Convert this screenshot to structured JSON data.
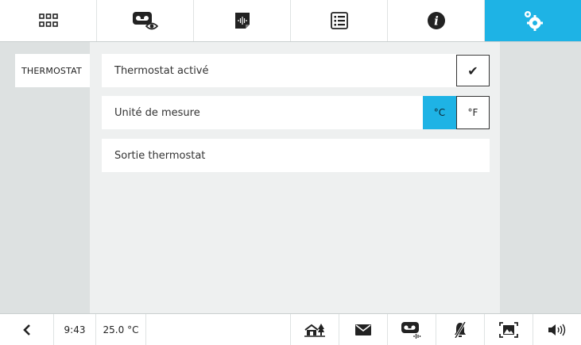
{
  "colors": {
    "accent": "#1eb3e5",
    "background": "#dde1e1",
    "panel": "#ffffff"
  },
  "top_tabs": [
    {
      "icon": "grid-icon",
      "active": false
    },
    {
      "icon": "voicemail-eye-icon",
      "active": false
    },
    {
      "icon": "audio-note-icon",
      "active": false
    },
    {
      "icon": "list-icon",
      "active": false
    },
    {
      "icon": "info-icon",
      "active": false
    },
    {
      "icon": "settings-gears-icon",
      "active": true
    }
  ],
  "sidebar": {
    "items": [
      {
        "label": "THERMOSTAT"
      }
    ]
  },
  "settings": {
    "thermostat_enabled": {
      "label": "Thermostat activé",
      "checked": true,
      "check_glyph": "✔"
    },
    "unit": {
      "label": "Unité de mesure",
      "options": [
        "°C",
        "°F"
      ],
      "selected": "°C"
    },
    "output": {
      "label": "Sortie thermostat"
    }
  },
  "bottombar": {
    "back_icon": "chevron-left-icon",
    "time": "9:43",
    "temperature": "25.0 °C",
    "icons": [
      "home-trees-icon",
      "mail-icon",
      "voicemail-audio-icon",
      "bell-muted-icon",
      "picture-frame-icon",
      "speaker-icon"
    ]
  }
}
